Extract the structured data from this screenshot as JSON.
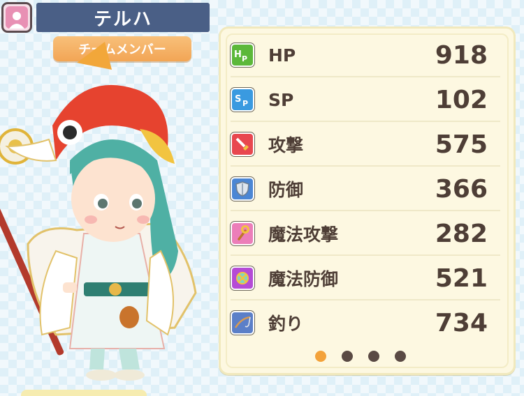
{
  "header": {
    "character_name": "テルハ",
    "team_badge": "チームメンバー",
    "profile_icon": "person-silhouette-icon"
  },
  "stats": [
    {
      "label": "HP",
      "value": "918",
      "icon": "hp-icon",
      "icon_color": "#5cb83a"
    },
    {
      "label": "SP",
      "value": "102",
      "icon": "sp-icon",
      "icon_color": "#3a9ae0"
    },
    {
      "label": "攻撃",
      "value": "575",
      "icon": "sword-icon",
      "icon_color": "#e8474f"
    },
    {
      "label": "防御",
      "value": "366",
      "icon": "shield-icon",
      "icon_color": "#4b86d4"
    },
    {
      "label": "魔法攻撃",
      "value": "282",
      "icon": "magic-staff-icon",
      "icon_color": "#ec7eb9"
    },
    {
      "label": "魔法防御",
      "value": "521",
      "icon": "magic-shield-icon",
      "icon_color": "#b54bd6"
    },
    {
      "label": "釣り",
      "value": "734",
      "icon": "fishing-rod-icon",
      "icon_color": "#5b7fc8"
    }
  ],
  "pagination": {
    "total": 4,
    "current": 1
  },
  "colors": {
    "name_bar": "#4a5f86",
    "team_badge": "#f2a555",
    "panel_bg": "#fdf8e1",
    "text": "#4e3e36",
    "active_dot": "#f3a23a"
  }
}
